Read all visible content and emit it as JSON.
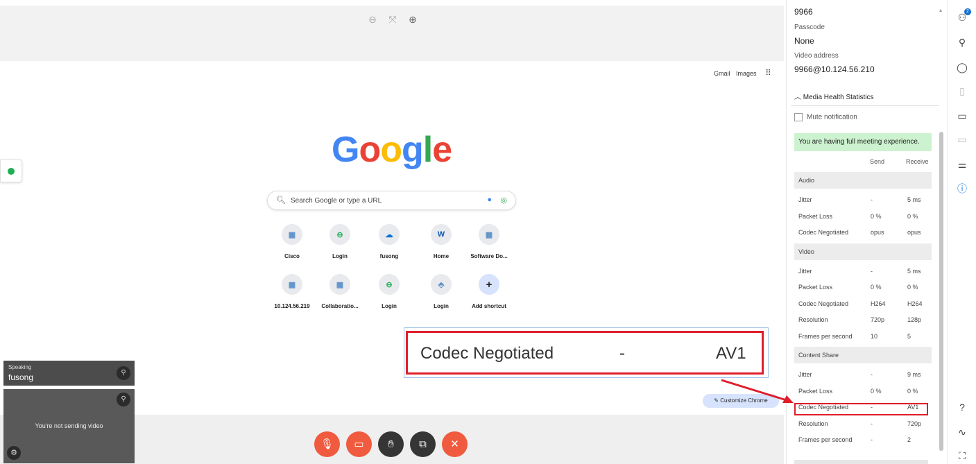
{
  "google": {
    "gmail": "Gmail",
    "images": "Images",
    "logo": [
      "G",
      "o",
      "o",
      "g",
      "l",
      "e"
    ],
    "logo_colors": [
      "#4285f4",
      "#ea4335",
      "#fbbc05",
      "#4285f4",
      "#34a853",
      "#ea4335"
    ],
    "search_placeholder": "Search Google or type a URL",
    "shortcuts": [
      {
        "label": "Cisco",
        "glyph": "▦"
      },
      {
        "label": "Login",
        "glyph": "⊖"
      },
      {
        "label": "fusong",
        "glyph": "☁"
      },
      {
        "label": "Home",
        "glyph": "W"
      },
      {
        "label": "Software Do...",
        "glyph": "▦"
      },
      {
        "label": "10.124.56.219",
        "glyph": "▦"
      },
      {
        "label": "Collaboratio...",
        "glyph": "▦"
      },
      {
        "label": "Login",
        "glyph": "⊖"
      },
      {
        "label": "Login",
        "glyph": "⬘"
      },
      {
        "label": "Add shortcut",
        "glyph": "+"
      }
    ],
    "customize": "Customize Chrome"
  },
  "callout": {
    "metric": "Codec Negotiated",
    "send": "-",
    "receive": "AV1"
  },
  "speaking": {
    "label": "Speaking",
    "name": "fusong"
  },
  "self_video": {
    "text": "You're not sending video"
  },
  "info": {
    "meeting_number": "9966",
    "passcode_label": "Passcode",
    "passcode_value": "None",
    "video_address_label": "Video address",
    "video_address_value": "9966@10.124.56.210",
    "mhs_title": "Media Health Statistics",
    "mute_notification": "Mute notification",
    "full_experience": "You are having full meeting experience.",
    "col_send": "Send",
    "col_receive": "Receive",
    "sections": [
      {
        "title": "Audio",
        "rows": [
          {
            "metric": "Jitter",
            "send": "-",
            "receive": "5 ms"
          },
          {
            "metric": "Packet Loss",
            "send": "0 %",
            "receive": "0 %"
          },
          {
            "metric": "Codec Negotiated",
            "send": "opus",
            "receive": "opus"
          }
        ]
      },
      {
        "title": "Video",
        "rows": [
          {
            "metric": "Jitter",
            "send": "-",
            "receive": "5 ms"
          },
          {
            "metric": "Packet Loss",
            "send": "0 %",
            "receive": "0 %"
          },
          {
            "metric": "Codec Negotiated",
            "send": "H264",
            "receive": "H264"
          },
          {
            "metric": "Resolution",
            "send": "720p",
            "receive": "128p"
          },
          {
            "metric": "Frames per second",
            "send": "10",
            "receive": "5"
          }
        ]
      },
      {
        "title": "Content Share",
        "rows": [
          {
            "metric": "Jitter",
            "send": "-",
            "receive": "9 ms"
          },
          {
            "metric": "Packet Loss",
            "send": "0 %",
            "receive": "0 %"
          },
          {
            "metric": "Codec Negotiated",
            "send": "-",
            "receive": "AV1"
          },
          {
            "metric": "Resolution",
            "send": "-",
            "receive": "720p"
          },
          {
            "metric": "Frames per second",
            "send": "-",
            "receive": "2"
          }
        ]
      }
    ]
  },
  "colors": {
    "end_red": "#f05a3e",
    "highlight_red": "#e01e2b",
    "success_green": "#cdf2cf",
    "accent_blue": "#1170cf"
  },
  "rail": {
    "participants_badge": "2",
    "icons": [
      "participants-icon",
      "contacts-icon",
      "chat-icon",
      "notes-icon",
      "captions-icon",
      "whiteboard-icon",
      "settings-sliders-icon",
      "info-icon",
      "help-icon",
      "activity-icon",
      "fullscreen-icon"
    ]
  }
}
